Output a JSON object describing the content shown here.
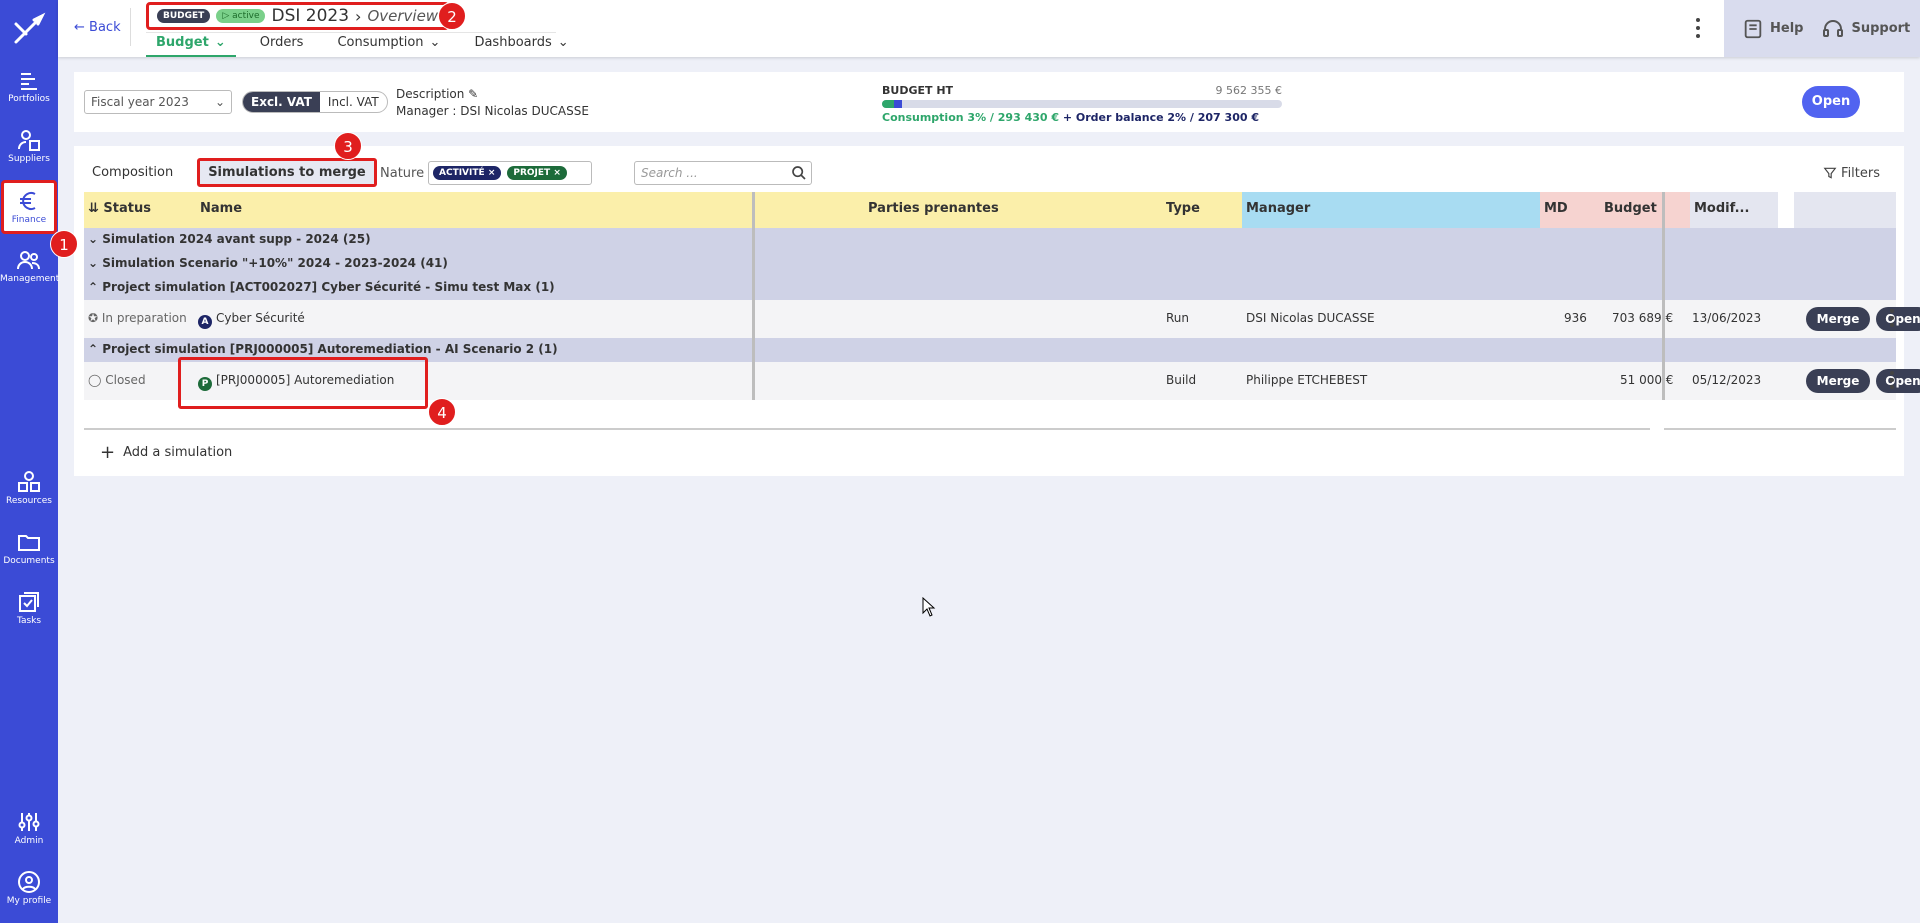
{
  "sidebar": {
    "items": [
      {
        "label": "Portfolios",
        "icon": "portfolios-icon"
      },
      {
        "label": "Suppliers",
        "icon": "suppliers-icon"
      },
      {
        "label": "Finance",
        "icon": "euro-icon"
      },
      {
        "label": "Management",
        "icon": "people-icon"
      },
      {
        "label": "Resources",
        "icon": "shapes-icon"
      },
      {
        "label": "Documents",
        "icon": "folder-icon"
      },
      {
        "label": "Tasks",
        "icon": "tasks-icon"
      },
      {
        "label": "Admin",
        "icon": "sliders-icon"
      },
      {
        "label": "My profile",
        "icon": "user-circle-icon"
      }
    ]
  },
  "header": {
    "back": "Back",
    "badge_budget": "BUDGET",
    "badge_active": "active",
    "title": "DSI 2023",
    "subtitle": "Overview",
    "tabs": [
      "Budget",
      "Orders",
      "Consumption",
      "Dashboards"
    ],
    "help": "Help",
    "support": "Support"
  },
  "summary": {
    "fiscal_year": "Fiscal year 2023",
    "vat_excl": "Excl. VAT",
    "vat_incl": "Incl. VAT",
    "description_label": "Description",
    "manager": "Manager : DSI Nicolas DUCASSE",
    "budget_label": "BUDGET HT",
    "budget_value": "9 562 355 €",
    "consumption_text": "Consumption 3% / 293 430 €",
    "order_text": "+ Order balance 2% / 207 300 €",
    "consumption_pct": 3,
    "order_pct": 2,
    "open": "Open"
  },
  "main": {
    "tabs": [
      "Composition",
      "Simulations to merge"
    ],
    "nature_label": "Nature",
    "chips": [
      "ACTIVITÉ",
      "PROJET"
    ],
    "search_placeholder": "Search ...",
    "filters": "Filters",
    "columns": [
      "Status",
      "Name",
      "Parties prenantes",
      "Type",
      "Manager",
      "MD",
      "Budget",
      "Modif..."
    ],
    "groups": [
      {
        "label": "Simulation 2024 avant supp - 2024",
        "count": "(25)"
      },
      {
        "label": "Simulation Scenario \"+10%\" 2024 - 2023-2024",
        "count": "(41)"
      },
      {
        "label": "Project simulation [ACT002027] Cyber Sécurité - Simu test Max",
        "count": "(1)"
      },
      {
        "label": "Project simulation [PRJ000005] Autoremediation - AI Scenario 2",
        "count": "(1)"
      }
    ],
    "rows": [
      {
        "status": "In preparation",
        "avatar": "A",
        "name": "Cyber Sécurité",
        "type": "Run",
        "manager": "DSI Nicolas DUCASSE",
        "md": "936",
        "budget": "703 689 €",
        "modified": "13/06/2023"
      },
      {
        "status": "Closed",
        "avatar": "P",
        "name": "[PRJ000005] Autoremediation",
        "type": "Build",
        "manager": "Philippe ETCHEBEST",
        "md": "",
        "budget": "51 000 €",
        "modified": "05/12/2023"
      }
    ],
    "merge": "Merge",
    "open": "Open",
    "add_simulation": "Add a simulation"
  },
  "callouts": [
    "1",
    "2",
    "3",
    "4"
  ],
  "colors": {
    "sidebar": "#3b4bd6",
    "accent_green": "#2ea66b",
    "highlight_red": "#e01e1e",
    "name_col": "#fbefaa",
    "manager_col": "#a8dcf2",
    "md_col": "#f6d3d0",
    "group_row": "#cfd2e6"
  }
}
